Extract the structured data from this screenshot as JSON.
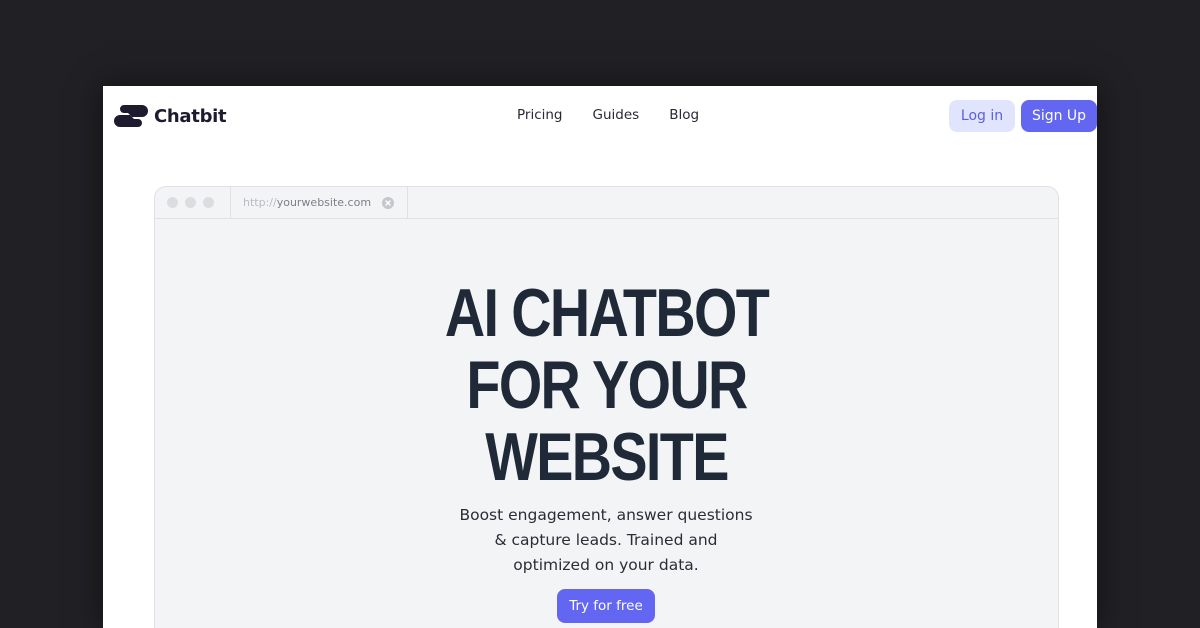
{
  "brand": {
    "name": "Chatbit",
    "logo_icon": "chatbit-logo-icon",
    "text_color": "#1e1b2e"
  },
  "nav": {
    "links": [
      {
        "label": "Pricing"
      },
      {
        "label": "Guides"
      },
      {
        "label": "Blog"
      }
    ],
    "login_label": "Log in",
    "signup_label": "Sign Up"
  },
  "browser": {
    "url_protocol": "http://",
    "url_domain": "yourwebsite.com",
    "close_icon": "close-icon"
  },
  "hero": {
    "title_lines": [
      "AI CHATBOT",
      "FOR YOUR",
      "WEBSITE"
    ],
    "subtitle": "Boost engagement, answer questions & capture leads. Trained and optimized on your data.",
    "cta_label": "Try for free"
  },
  "colors": {
    "accent": "#6366f1",
    "accent_light": "#e1e4fd",
    "background": "#212125",
    "panel": "#f3f4f6",
    "title": "#1f2937"
  }
}
